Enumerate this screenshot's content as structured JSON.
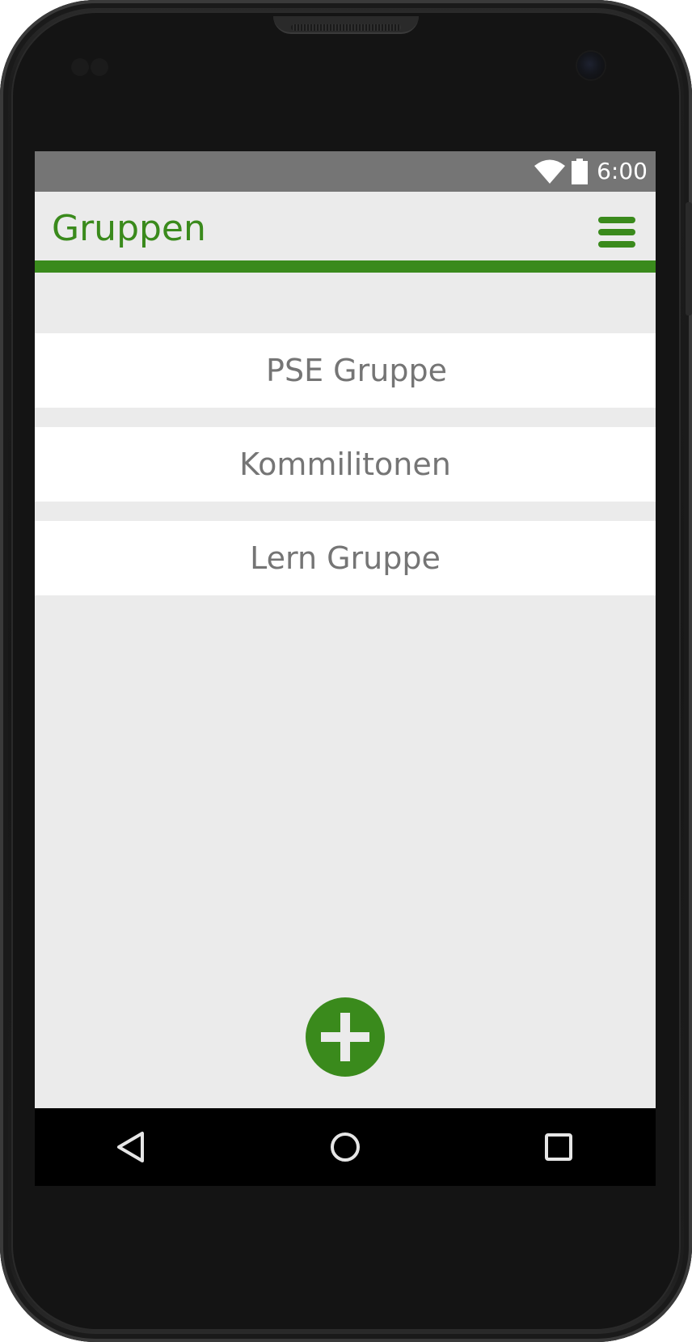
{
  "status_bar": {
    "time": "6:00",
    "icons": [
      "wifi-icon",
      "battery-icon"
    ]
  },
  "app_bar": {
    "title": "Gruppen",
    "menu_icon": "hamburger-menu-icon"
  },
  "groups": [
    {
      "name": "PSE Gruppe"
    },
    {
      "name": "Kommilitonen"
    },
    {
      "name": "Lern Gruppe"
    }
  ],
  "fab": {
    "icon": "plus-icon"
  },
  "nav_bar": {
    "buttons": [
      "back-icon",
      "home-icon",
      "recents-icon"
    ]
  },
  "colors": {
    "accent": "#3a8a1c",
    "status_bar": "#757575",
    "background": "#ebebeb",
    "list_item": "#ffffff",
    "list_text": "#757575",
    "nav_bar": "#000000"
  }
}
